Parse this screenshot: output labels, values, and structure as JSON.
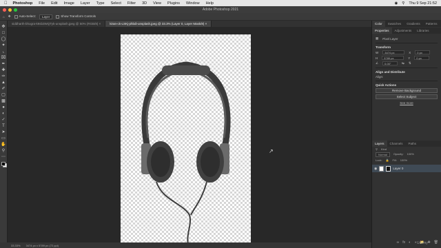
{
  "menubar": {
    "app_name": "Photoshop",
    "items": [
      "File",
      "Edit",
      "Image",
      "Layer",
      "Type",
      "Select",
      "Filter",
      "3D",
      "View",
      "Plugins",
      "Window",
      "Help"
    ],
    "clock": "Thu 9 Sep 21:52"
  },
  "window": {
    "title": "Adobe Photoshop 2021"
  },
  "options_bar": {
    "auto_select_label": "Auto-Select:",
    "auto_select_value": "Layer",
    "transform_controls_label": "Show Transform Controls"
  },
  "document_tabs": [
    {
      "label": "siddharth-bhogra-k9sb3WQTyk-unsplash.jpeg @ 50% (RGB/8) ×",
      "active": false
    },
    {
      "label": "kiran-ck-LSKj-phbdi-unsplash.jpeg @ 33.3% (Layer 0, Layer Mask/8) ×",
      "active": true
    }
  ],
  "status_bar": {
    "zoom": "33.33%",
    "doc_info": "3474 px x 5789 px (72 ppi)"
  },
  "panels": {
    "top_tabs": [
      "Color",
      "Swatches",
      "Gradients",
      "Patterns"
    ],
    "prop_tabs": [
      "Properties",
      "Adjustments",
      "Libraries"
    ],
    "pixel_layer_label": "Pixel Layer",
    "transform": {
      "title": "Transform",
      "w_label": "W",
      "w_value": "3474 px",
      "x_label": "X",
      "x_value": "0 px",
      "h_label": "H",
      "h_value": "5789 px",
      "y_label": "Y",
      "y_value": "0 px",
      "angle_value": "0.00°"
    },
    "align": {
      "title": "Align and Distribute",
      "subtitle": "Align:"
    },
    "quick_actions": {
      "title": "Quick Actions",
      "remove_bg": "Remove Background",
      "select_subject": "Select Subject",
      "see_more": "See more"
    },
    "layers": {
      "tabs": [
        "Layers",
        "Channels",
        "Paths"
      ],
      "kind_label": "Kind",
      "blend_mode": "Normal",
      "opacity_label": "Opacity:",
      "opacity_value": "100%",
      "lock_label": "Lock:",
      "fill_label": "Fill:",
      "fill_value": "100%",
      "layer_name": "Layer 0"
    }
  },
  "watermark": "Udemy",
  "colors": {
    "accent": "#3f4a55",
    "canvas_bg": "#282828"
  }
}
